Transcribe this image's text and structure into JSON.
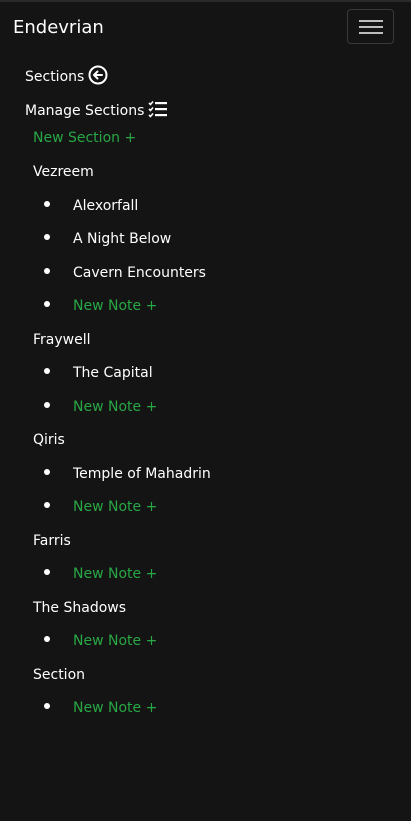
{
  "brand": "Endevrian",
  "sidebar": {
    "sections_label": "Sections",
    "manage_label": "Manage Sections",
    "new_section": "New Section +",
    "groups": [
      {
        "name": "Vezreem",
        "notes": [
          "Alexorfall",
          "A Night Below",
          "Cavern Encounters"
        ],
        "new_note": "New Note +"
      },
      {
        "name": "Fraywell",
        "notes": [
          "The Capital"
        ],
        "new_note": "New Note +"
      },
      {
        "name": "Qiris",
        "notes": [
          "Temple of Mahadrin"
        ],
        "new_note": "New Note +"
      },
      {
        "name": "Farris",
        "notes": [],
        "new_note": "New Note +"
      },
      {
        "name": "The Shadows",
        "notes": [],
        "new_note": "New Note +"
      },
      {
        "name": "Section",
        "notes": [],
        "new_note": "New Note +"
      }
    ]
  },
  "colors": {
    "background": "#141414",
    "accent_green": "#28a745",
    "text": "#ffffff"
  },
  "icons": {
    "back": "arrow-left-circle-icon",
    "manage": "checklist-icon",
    "menu": "hamburger-icon"
  }
}
